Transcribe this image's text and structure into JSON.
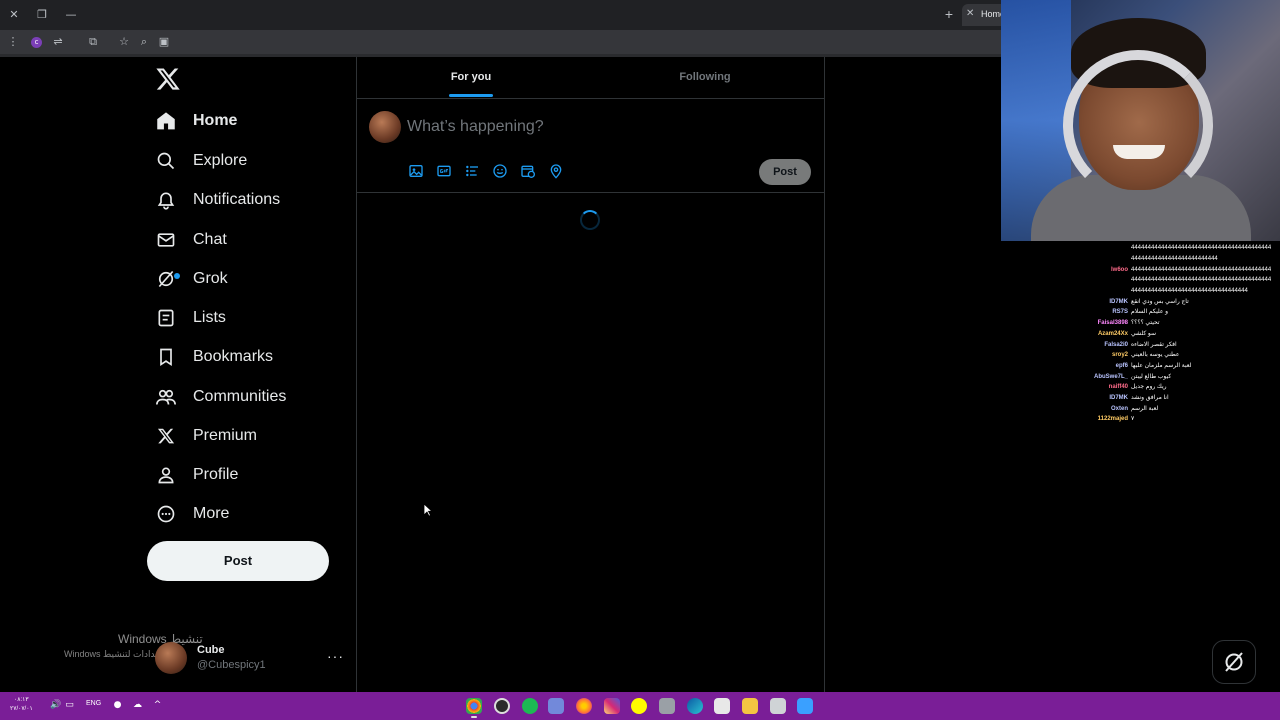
{
  "browser": {
    "tab_title": "Home",
    "new_tab_icon": "plus-icon",
    "close_icon": "close-icon"
  },
  "sidebar": {
    "items": [
      {
        "label": "Home",
        "icon": "home-icon",
        "active": true
      },
      {
        "label": "Explore",
        "icon": "search-icon"
      },
      {
        "label": "Notifications",
        "icon": "bell-icon"
      },
      {
        "label": "Chat",
        "icon": "mail-icon"
      },
      {
        "label": "Grok",
        "icon": "grok-icon"
      },
      {
        "label": "Lists",
        "icon": "list-icon"
      },
      {
        "label": "Bookmarks",
        "icon": "bookmark-icon"
      },
      {
        "label": "Communities",
        "icon": "communities-icon"
      },
      {
        "label": "Premium",
        "icon": "x-logo-icon"
      },
      {
        "label": "Profile",
        "icon": "person-icon"
      },
      {
        "label": "More",
        "icon": "more-circle-icon"
      }
    ],
    "post_button": "Post",
    "profile": {
      "name": "Cube",
      "handle": "@Cubespicy1",
      "more": "···"
    }
  },
  "watermark": {
    "line1": "Windows تنشيط",
    "line2": "Windows بإعدادات لتنشيط"
  },
  "main": {
    "tabs": [
      {
        "label": "For you",
        "active": true
      },
      {
        "label": "Following",
        "active": false
      }
    ],
    "compose": {
      "placeholder": "What’s happening?",
      "post_label": "Post"
    }
  },
  "chat": [
    {
      "user": "",
      "msg": "444444444444444444444444444444444444444444",
      "color": "#ffffff"
    },
    {
      "user": "",
      "msg": "44444444444444444444444444",
      "color": "#ffffff"
    },
    {
      "user": "lw6oo",
      "msg": "444444444444444444444444444444444444444444",
      "color": "#ff6b8a"
    },
    {
      "user": "",
      "msg": "444444444444444444444444444444444444444444",
      "color": "#ffffff"
    },
    {
      "user": "",
      "msg": "44444444444444444444444444444444444",
      "color": "#ffffff"
    },
    {
      "user": "ID7MK",
      "msg": "تاج راسي بس ودي انقع",
      "color": "#b9c4ff"
    },
    {
      "user": "RS7S",
      "msg": "و عليكم السلام",
      "color": "#b9c4ff"
    },
    {
      "user": "Faisal3898",
      "msg": "تحيتي ؟؟؟؟",
      "color": "#ff88ff"
    },
    {
      "user": "Azam24Xx",
      "msg": "سو كلشي",
      "color": "#ffcc66"
    },
    {
      "user": "Falsa2i0",
      "msg": "افكر تقصر الاضاءه",
      "color": "#b9c4ff"
    },
    {
      "user": "sroy2",
      "msg": "عطني يوسه بالعيني",
      "color": "#ffcc66"
    },
    {
      "user": "epf6",
      "msg": "لعبة الرسم ملزمان علبها",
      "color": "#b9c4ff"
    },
    {
      "user": "AbuSwe7L_",
      "msg": "كيوب طالع ليبتن",
      "color": "#b9c4ff"
    },
    {
      "user": "naiff40",
      "msg": "ريك روم جديل",
      "color": "#ff6b8a"
    },
    {
      "user": "ID7MK",
      "msg": "انا مرافق ونشد",
      "color": "#b9c4ff"
    },
    {
      "user": "Oxten",
      "msg": "لعبة الرسم",
      "color": "#b9c4ff"
    },
    {
      "user": "1122majed",
      "msg": "٧",
      "color": "#ffcc66"
    }
  ],
  "taskbar": {
    "clock_time": "٠٨:١٣",
    "clock_date": "٢٧/٠٧/٠١",
    "lang": "ENG"
  }
}
